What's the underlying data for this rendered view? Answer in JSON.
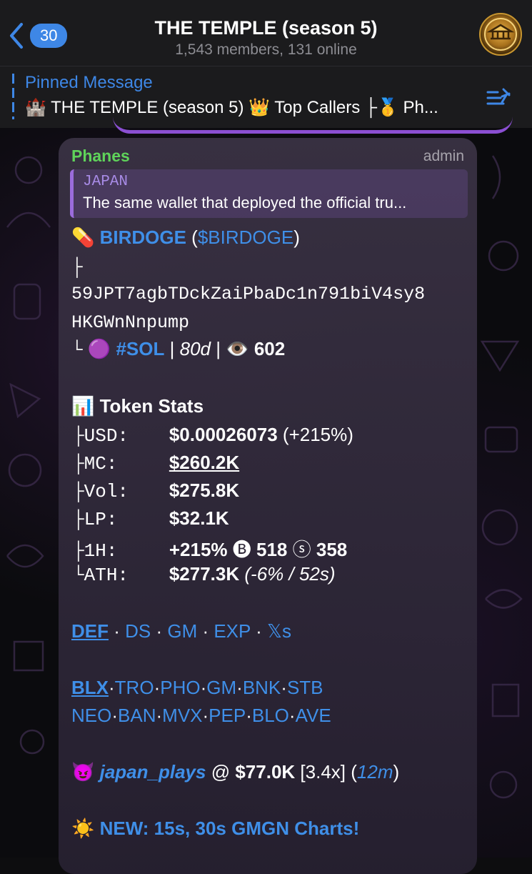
{
  "header": {
    "back_count": "30",
    "title": "THE TEMPLE (season 5)",
    "subtitle": "1,543 members, 131 online"
  },
  "pinned": {
    "label": "Pinned Message",
    "text": "🏰 THE TEMPLE (season 5) 👑 Top Callers ├🥇 Ph..."
  },
  "message": {
    "sender": "Phanes",
    "role": "admin",
    "reply": {
      "name": "JAPAN",
      "text": "The same wallet that deployed the official tru..."
    },
    "token": {
      "icon": "💊",
      "name": "BIRDOGE",
      "ticker": "$BIRDOGE",
      "branch": "├",
      "address_line1": "59JPT7agbTDckZaiPbaDc1n791biV4sy8",
      "address_line2": "HKGWnNnpump",
      "end_branch": "└",
      "chain_icon": "🟣",
      "chain": "#SOL",
      "age": "80d",
      "views_icon": "👁️",
      "views": "602"
    },
    "stats": {
      "icon": "📊",
      "title": "Token Stats",
      "rows": [
        {
          "branch": "├",
          "key": "USD:",
          "value": "$0.00026073",
          "extra": "(+215%)"
        },
        {
          "branch": "├",
          "key": "MC:",
          "value": "$260.2K",
          "extra": ""
        },
        {
          "branch": "├",
          "key": "Vol:",
          "value": "$275.8K",
          "extra": ""
        },
        {
          "branch": "├",
          "key": "LP:",
          "value": "$32.1K",
          "extra": ""
        },
        {
          "branch": "├",
          "key": "1H:",
          "value": "+215%",
          "b_icon": "🅑",
          "b_val": "518",
          "s_icon": "ⓢ",
          "s_val": "358"
        },
        {
          "branch": "└",
          "key": "ATH:",
          "value": "$277.3K",
          "extra": "(-6% / 52s)"
        }
      ]
    },
    "links1": [
      "DEF",
      "DS",
      "GM",
      "EXP",
      "𝕏s"
    ],
    "links2": [
      "BLX",
      "TRO",
      "PHO",
      "GM",
      "BNK",
      "STB"
    ],
    "links3": [
      "NEO",
      "BAN",
      "MVX",
      "PEP",
      "BLO",
      "AVE"
    ],
    "caller": {
      "icon": "😈",
      "name": "japan_plays",
      "at": "@",
      "price": "$77.0K",
      "multiple": "[3.4x]",
      "time": "12m"
    },
    "news": {
      "icon": "☀️",
      "text": "NEW: 15s, 30s GMGN Charts!"
    }
  },
  "colors": {
    "accent": "#3e87e6",
    "sender": "#5fd35a",
    "reply_bar": "#9b6cdc"
  }
}
